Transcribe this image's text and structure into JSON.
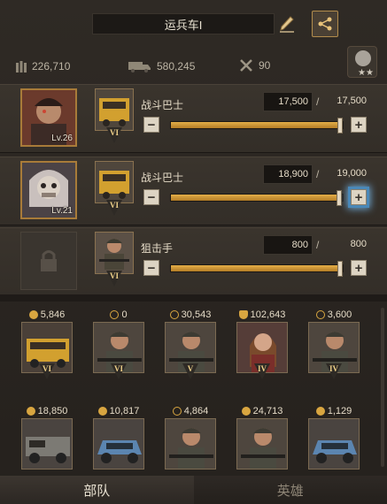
{
  "header": {
    "title": "运兵车I"
  },
  "stats": {
    "troops": "226,710",
    "capacity": "580,245",
    "tools": "90"
  },
  "squads": [
    {
      "hero_level": "Lv.26",
      "unit_name": "战斗巴士",
      "unit_rank": "VI",
      "count": "17,500",
      "max": "17,500",
      "fill": 1.0,
      "plus_highlight": false
    },
    {
      "hero_level": "Lv.21",
      "unit_name": "战斗巴士",
      "unit_rank": "VI",
      "count": "18,900",
      "max": "19,000",
      "fill": 0.995,
      "plus_highlight": true
    },
    {
      "hero_level": "",
      "unit_name": "狙击手",
      "unit_rank": "VI",
      "count": "800",
      "max": "800",
      "fill": 1.0,
      "plus_highlight": false
    }
  ],
  "separator": "/",
  "buttons": {
    "minus": "−",
    "plus": "+"
  },
  "units": [
    {
      "count": "5,846",
      "icon": "power-icon",
      "rank": "VI",
      "kind": "bus"
    },
    {
      "count": "0",
      "icon": "crosshair-icon",
      "rank": "VI",
      "kind": "soldier"
    },
    {
      "count": "30,543",
      "icon": "crosshair-icon",
      "rank": "V",
      "kind": "soldier"
    },
    {
      "count": "102,643",
      "icon": "shield-icon",
      "rank": "IV",
      "kind": "woman"
    },
    {
      "count": "3,600",
      "icon": "crosshair-icon",
      "rank": "IV",
      "kind": "soldier"
    },
    {
      "count": "18,850",
      "icon": "power-icon",
      "rank": "",
      "kind": "truck"
    },
    {
      "count": "10,817",
      "icon": "power-icon",
      "rank": "",
      "kind": "car"
    },
    {
      "count": "4,864",
      "icon": "crosshair-icon",
      "rank": "",
      "kind": "soldier"
    },
    {
      "count": "24,713",
      "icon": "power-icon",
      "rank": "",
      "kind": "soldier"
    },
    {
      "count": "1,129",
      "icon": "power-icon",
      "rank": "",
      "kind": "car"
    }
  ],
  "tabs": {
    "troops": "部队",
    "heroes": "英雄"
  },
  "colors": {
    "accent": "#d9a640",
    "slider": "#e3ae48",
    "highlight": "#6fa9d6"
  }
}
